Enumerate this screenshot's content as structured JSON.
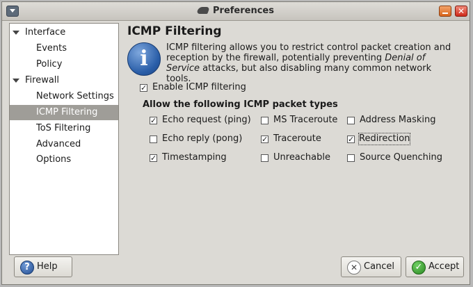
{
  "window": {
    "title": "Preferences"
  },
  "sidebar": {
    "items": [
      {
        "label": "Interface",
        "level": 0,
        "expanded": true
      },
      {
        "label": "Events",
        "level": 1
      },
      {
        "label": "Policy",
        "level": 1
      },
      {
        "label": "Firewall",
        "level": 0,
        "expanded": true
      },
      {
        "label": "Network Settings",
        "level": 1
      },
      {
        "label": "ICMP Filtering",
        "level": 1,
        "selected": true
      },
      {
        "label": "ToS Filtering",
        "level": 1
      },
      {
        "label": "Advanced Options",
        "level": 1
      }
    ]
  },
  "main": {
    "title": "ICMP Filtering",
    "description_pre": "ICMP filtering allows you to restrict control packet creation and reception by the firewall, potentially preventing ",
    "description_em": "Denial of Service",
    "description_post": " attacks, but also disabling many common network tools.",
    "enable": {
      "label": "Enable ICMP filtering",
      "checked": true
    },
    "section_label": "Allow the following ICMP packet types",
    "packet_types": [
      {
        "label": "Echo request (ping)",
        "checked": true
      },
      {
        "label": "MS Traceroute",
        "checked": false
      },
      {
        "label": "Address Masking",
        "checked": false
      },
      {
        "label": "Echo reply (pong)",
        "checked": false
      },
      {
        "label": "Traceroute",
        "checked": true
      },
      {
        "label": "Redirection",
        "checked": true
      },
      {
        "label": "Timestamping",
        "checked": true
      },
      {
        "label": "Unreachable",
        "checked": false
      },
      {
        "label": "Source Quenching",
        "checked": false
      }
    ]
  },
  "buttons": {
    "help": {
      "label": "Help",
      "icon": "help-icon"
    },
    "cancel": {
      "label": "Cancel",
      "icon": "cancel-icon"
    },
    "accept": {
      "label": "Accept",
      "icon": "accept-icon"
    }
  }
}
